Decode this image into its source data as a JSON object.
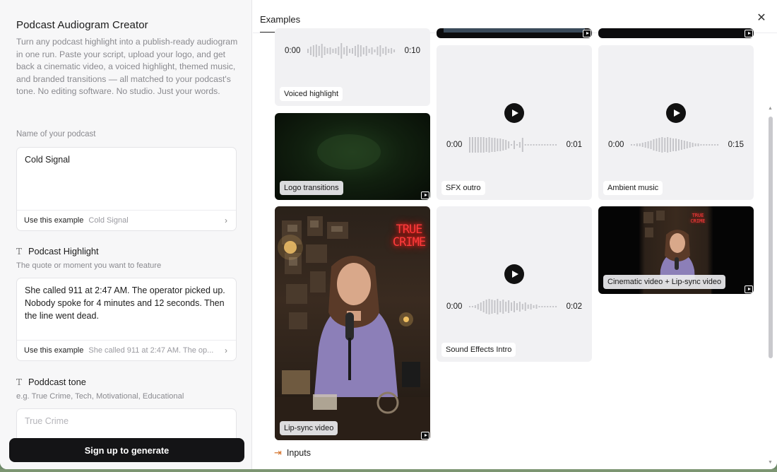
{
  "left": {
    "title": "Podcast Audiogram Creator",
    "description": "Turn any podcast highlight into a publish-ready audiogram in one run. Paste your script, upload your logo, and get back a cinematic video, a voiced highlight, themed music, and branded transitions — all matched to your podcast's tone. No editing software. No studio. Just your words.",
    "fields": {
      "podcast_name": {
        "label": "Name of your podcast",
        "value": "Cold Signal",
        "example_label": "Use this example",
        "example_value": "Cold Signal"
      },
      "highlight": {
        "title": "Podcast Highlight",
        "hint": "The quote or moment you want to feature",
        "value": "She called 911 at 2:47 AM. The operator picked up. Nobody spoke for 4 minutes and 12 seconds. Then the line went dead.",
        "example_label": "Use this example",
        "example_value": "She called 911 at 2:47 AM. The op..."
      },
      "tone": {
        "title": "Poddcast tone",
        "hint": "e.g. True Crime, Tech, Motivational, Educational",
        "placeholder": "True Crime"
      }
    },
    "generate_button": "Sign up to generate"
  },
  "right": {
    "tab": "Examples",
    "close_icon": "close-icon",
    "cards": {
      "voiced_highlight": {
        "label": "Voiced highlight",
        "start": "0:00",
        "end": "0:10"
      },
      "logo_transitions": {
        "label": "Logo transitions"
      },
      "sfx_outro": {
        "label": "SFX outro",
        "start": "0:00",
        "end": "0:01"
      },
      "ambient_music": {
        "label": "Ambient music",
        "start": "0:00",
        "end": "0:15"
      },
      "lip_sync_video": {
        "label": "Lip-sync video",
        "sign_text": "TRUE CRIME"
      },
      "sound_effects_intro": {
        "label": "Sound Effects Intro",
        "start": "0:00",
        "end": "0:02"
      },
      "cinematic_lipsync": {
        "label": "Cinematic video + Lip-sync video",
        "sign_text": "TRUE CRIME"
      }
    },
    "inputs_label": "Inputs"
  },
  "colors": {
    "accent_dark": "#141416",
    "neon_sign": "#ff3b3b",
    "wave_gray": "#c4c4c8"
  }
}
